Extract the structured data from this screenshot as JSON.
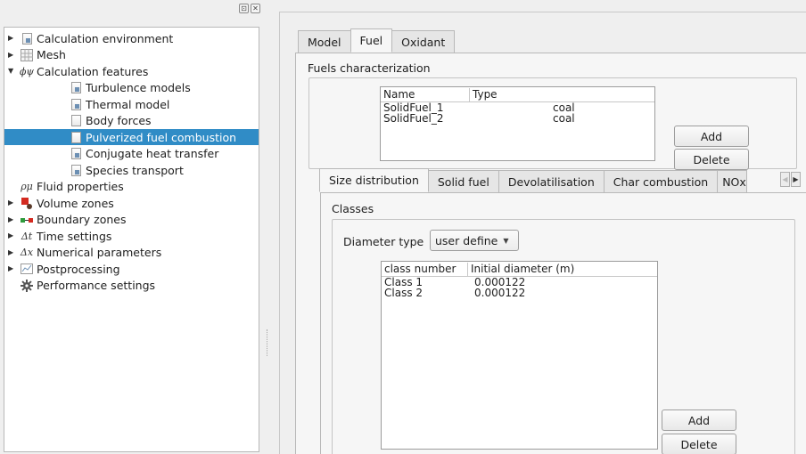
{
  "dock": {
    "buttons": [
      "⊡",
      "✕"
    ]
  },
  "tree": [
    {
      "label": "Calculation environment",
      "icon": "document-icon",
      "expand": "collapsed",
      "level": 0
    },
    {
      "label": "Mesh",
      "icon": "grid-icon",
      "expand": "collapsed",
      "level": 0
    },
    {
      "label": "Calculation features",
      "icon": "math-icon",
      "glyph": "ϕψ",
      "expand": "expanded",
      "level": 0
    },
    {
      "label": "Turbulence models",
      "icon": "document-icon",
      "expand": "none",
      "level": 1
    },
    {
      "label": "Thermal model",
      "icon": "document-icon",
      "expand": "none",
      "level": 1
    },
    {
      "label": "Body forces",
      "icon": "document-plain-icon",
      "expand": "none",
      "level": 1
    },
    {
      "label": "Pulverized fuel combustion",
      "icon": "document-plain-icon",
      "expand": "none",
      "level": 1,
      "selected": true
    },
    {
      "label": "Conjugate heat transfer",
      "icon": "document-icon",
      "expand": "none",
      "level": 1
    },
    {
      "label": "Species transport",
      "icon": "document-icon",
      "expand": "none",
      "level": 1
    },
    {
      "label": "Fluid properties",
      "icon": "math-icon",
      "glyph": "ρμ",
      "expand": "none",
      "level": 0
    },
    {
      "label": "Volume zones",
      "icon": "volume-zones-icon",
      "expand": "collapsed",
      "level": 0
    },
    {
      "label": "Boundary zones",
      "icon": "boundary-zones-icon",
      "expand": "collapsed",
      "level": 0
    },
    {
      "label": "Time settings",
      "icon": "math-icon",
      "glyph": "Δt",
      "expand": "collapsed",
      "level": 0
    },
    {
      "label": "Numerical parameters",
      "icon": "math-icon",
      "glyph": "Δx",
      "expand": "collapsed",
      "level": 0
    },
    {
      "label": "Postprocessing",
      "icon": "chart-icon",
      "expand": "collapsed",
      "level": 0
    },
    {
      "label": "Performance settings",
      "icon": "gear-icon",
      "expand": "none",
      "level": 0
    }
  ],
  "top_tabs": [
    "Model",
    "Fuel",
    "Oxidant"
  ],
  "top_tabs_active": 1,
  "fuels": {
    "title": "Fuels characterization",
    "columns": [
      "Name",
      "Type"
    ],
    "rows": [
      {
        "name": "SolidFuel_1",
        "type": "coal"
      },
      {
        "name": "SolidFuel_2",
        "type": "coal"
      }
    ],
    "add_label": "Add",
    "delete_label": "Delete"
  },
  "inner_tabs": [
    "Size distribution",
    "Solid fuel",
    "Devolatilisation",
    "Char combustion",
    "NOx"
  ],
  "inner_tabs_active": 0,
  "classes": {
    "title": "Classes",
    "diameter_type_label": "Diameter type",
    "diameter_type_value": "user define",
    "columns": [
      "class number",
      "Initial diameter (m)"
    ],
    "rows": [
      {
        "name": "Class 1",
        "diameter": "0.000122"
      },
      {
        "name": "Class 2",
        "diameter": "0.000122"
      }
    ],
    "add_label": "Add",
    "delete_label": "Delete"
  },
  "colors": {
    "selection": "#308cc6",
    "background": "#efefef",
    "pane": "#f6f6f6"
  }
}
